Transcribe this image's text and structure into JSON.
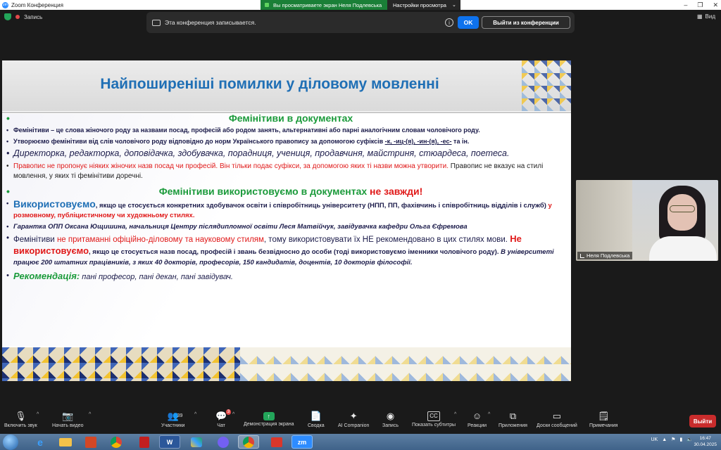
{
  "window": {
    "title": "Zoom Конференция",
    "share_banner": "Вы просматриваете экран Неля Подлевська",
    "view_settings": "Настройки просмотра",
    "view_label": "Вид",
    "recording_label": "Запись"
  },
  "notice": {
    "text": "Эта конференция записывается.",
    "ok": "OK",
    "leave": "Выйти из конференции"
  },
  "slide": {
    "title": "Найпоширеніші помилки у діловому мовленні",
    "heading1": "Фемінітиви в документах",
    "p1": "Фемінітиви – це слова жіночого роду за назвами посад, професій або родом занять, альтернативні або парні аналогічним словам чоловічого роду.",
    "p2_a": "Утворюємо фемінітиви від слів чоловічого роду відповідно до норм Українського правопису за допомогою суфіксів ",
    "p2_suffixes": "-к, -иц-(я), -ин-(я), -ес-",
    "p2_b": " та ін.",
    "p3": "Директорка, редакторка, доповідачка, здобувачка, порадниця, учениця, продавчиня, майстриня, стюардеса, поетеса.",
    "p4_red": "Правопис не пропонує ніяких жіночих назв посад чи професій. Він тільки подає суфікси, за допомогою яких ті назви можна утворити.",
    "p4_rest": " Правопис не вказує на стилі мовлення, у яких ті фемінітиви доречні.",
    "heading2_a": "Фемінітиви використовуємо в документах ",
    "heading2_b": "не завжди!",
    "p5_strong": "Використовуємо",
    "p5_text": ", якщо це стосується конкретних здобувачок освіти і співробітниць університету (НПП, ПП, фахівчинь і співробітниць відділів і служб) ",
    "p5_red": "у розмовному, публіцистичному чи художньому стилях.",
    "p6": "Гарантка ОПП Оксана Ющишина, начальниця Центру післядипломної освіти Леся Матвійчук, завідувачка кафедри Ольга Єфремова",
    "p7_a": "Фемінітиви ",
    "p7_red": "не притаманні офіційно-діловому та науковому стилям",
    "p7_b": ", тому використовувати їх НЕ рекомендовано в цих стилях мови. ",
    "p7_strong": "Не використовуємо",
    "p7_c": ", якщо це стосується назв посад, професій і звань безвідносно до особи (тоді використовуємо іменники чоловічого роду). ",
    "p7_italic": "В університеті працює 200 штатних працівників, з яких 40 докторів, професорів, 150 кандидатів, доцентів, 10 докторів філософії.",
    "p8_label": "Рекомендація:",
    "p8_text": " пані професор, пані декан, пані завідувач."
  },
  "video": {
    "name": "Неля Подлевська"
  },
  "toolbar": {
    "mute": "Включить звук",
    "video": "Начать видео",
    "participants": "Участники",
    "participants_count": "39",
    "chat": "Чат",
    "chat_badge": "3",
    "share": "Демонстрация экрана",
    "whiteboard": "Сводка",
    "ai": "AI Companion",
    "record": "Запись",
    "captions": "Показать субтитры",
    "cc": "CC",
    "reactions": "Реакции",
    "apps": "Приложения",
    "whiteboards": "Доски сообщений",
    "notes": "Примечания",
    "exit": "Выйти"
  },
  "taskbar": {
    "lang": "UK",
    "time": "16:47",
    "date": "30.04.2025",
    "apps": [
      "IE",
      "Files",
      "PPT",
      "Chrome",
      "PDF",
      "Word",
      "Paint",
      "Viber",
      "Chrome2",
      "Mail",
      "Zoom"
    ],
    "zoom_label": "zm",
    "word_label": "W"
  }
}
